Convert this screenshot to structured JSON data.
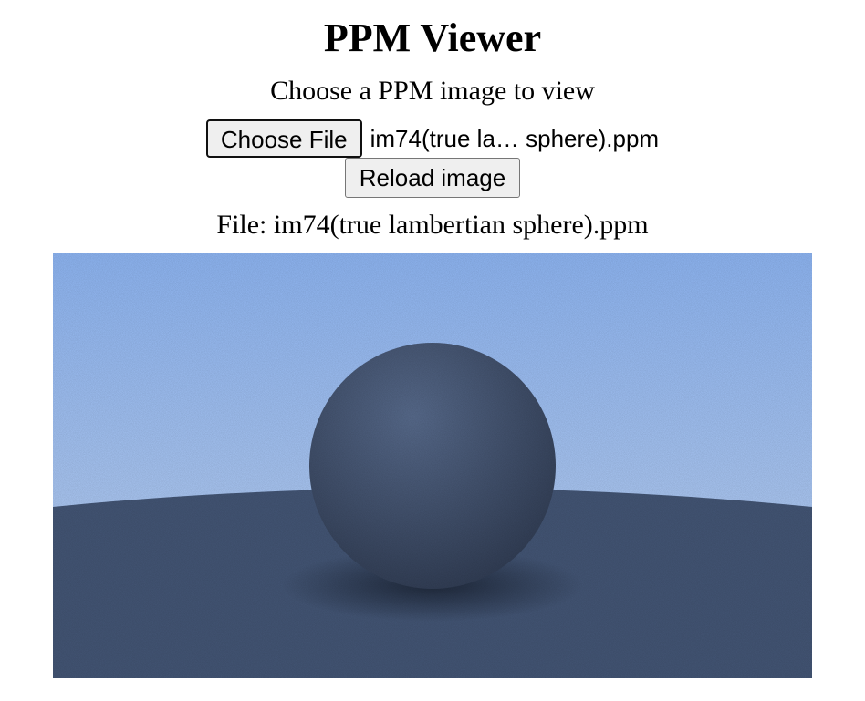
{
  "header": {
    "title": "PPM Viewer",
    "subtitle": "Choose a PPM image to view"
  },
  "file_input": {
    "button_label": "Choose File",
    "chosen_filename": "im74(true la… sphere).ppm"
  },
  "toolbar": {
    "reload_label": "Reload image"
  },
  "file_info": {
    "label": "File: im74(true lambertian sphere).ppm"
  },
  "render": {
    "sky_top_color": "#94bdfd",
    "sky_bottom_color": "#c5dbfc",
    "ground_color": "#46597a",
    "sphere_light_color": "#5b6f92",
    "sphere_dark_color": "#2f3b52"
  }
}
